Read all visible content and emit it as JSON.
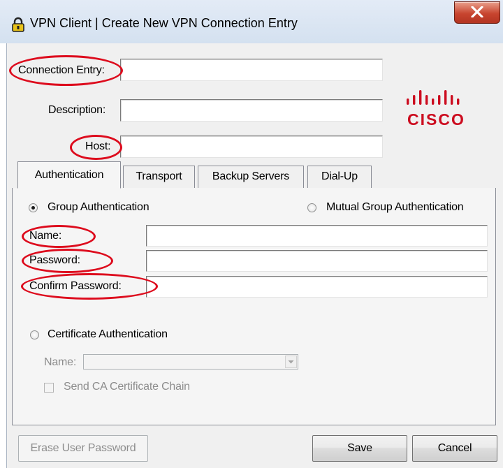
{
  "window": {
    "title": "VPN Client  |  Create New VPN Connection Entry",
    "close_glyph": "x"
  },
  "form": {
    "connection_entry_label": "Connection Entry:",
    "connection_entry_value": "",
    "description_label": "Description:",
    "description_value": "",
    "host_label": "Host:",
    "host_value": ""
  },
  "logo": {
    "brand_text": "CISCO",
    "accent_color": "#cc0c1f"
  },
  "tabs": [
    {
      "label": "Authentication",
      "selected": true
    },
    {
      "label": "Transport",
      "selected": false
    },
    {
      "label": "Backup Servers",
      "selected": false
    },
    {
      "label": "Dial-Up",
      "selected": false
    }
  ],
  "authentication": {
    "group_auth_label": "Group Authentication",
    "group_auth_selected": true,
    "mutual_group_auth_label": "Mutual Group Authentication",
    "mutual_group_auth_selected": false,
    "name_label": "Name:",
    "name_value": "",
    "password_label": "Password:",
    "password_value": "",
    "confirm_password_label": "Confirm Password:",
    "confirm_password_value": "",
    "cert_auth_label": "Certificate Authentication",
    "cert_auth_selected": false,
    "cert_name_label": "Name:",
    "cert_name_value": "",
    "send_ca_chain_label": "Send CA Certificate Chain",
    "send_ca_chain_checked": false
  },
  "buttons": {
    "erase_user_password": "Erase User Password",
    "save": "Save",
    "cancel": "Cancel"
  },
  "icons": [
    "lock-icon",
    "close-icon",
    "cisco-logo",
    "dropdown-arrow-icon"
  ],
  "annotation_color": "#dd0b1d"
}
